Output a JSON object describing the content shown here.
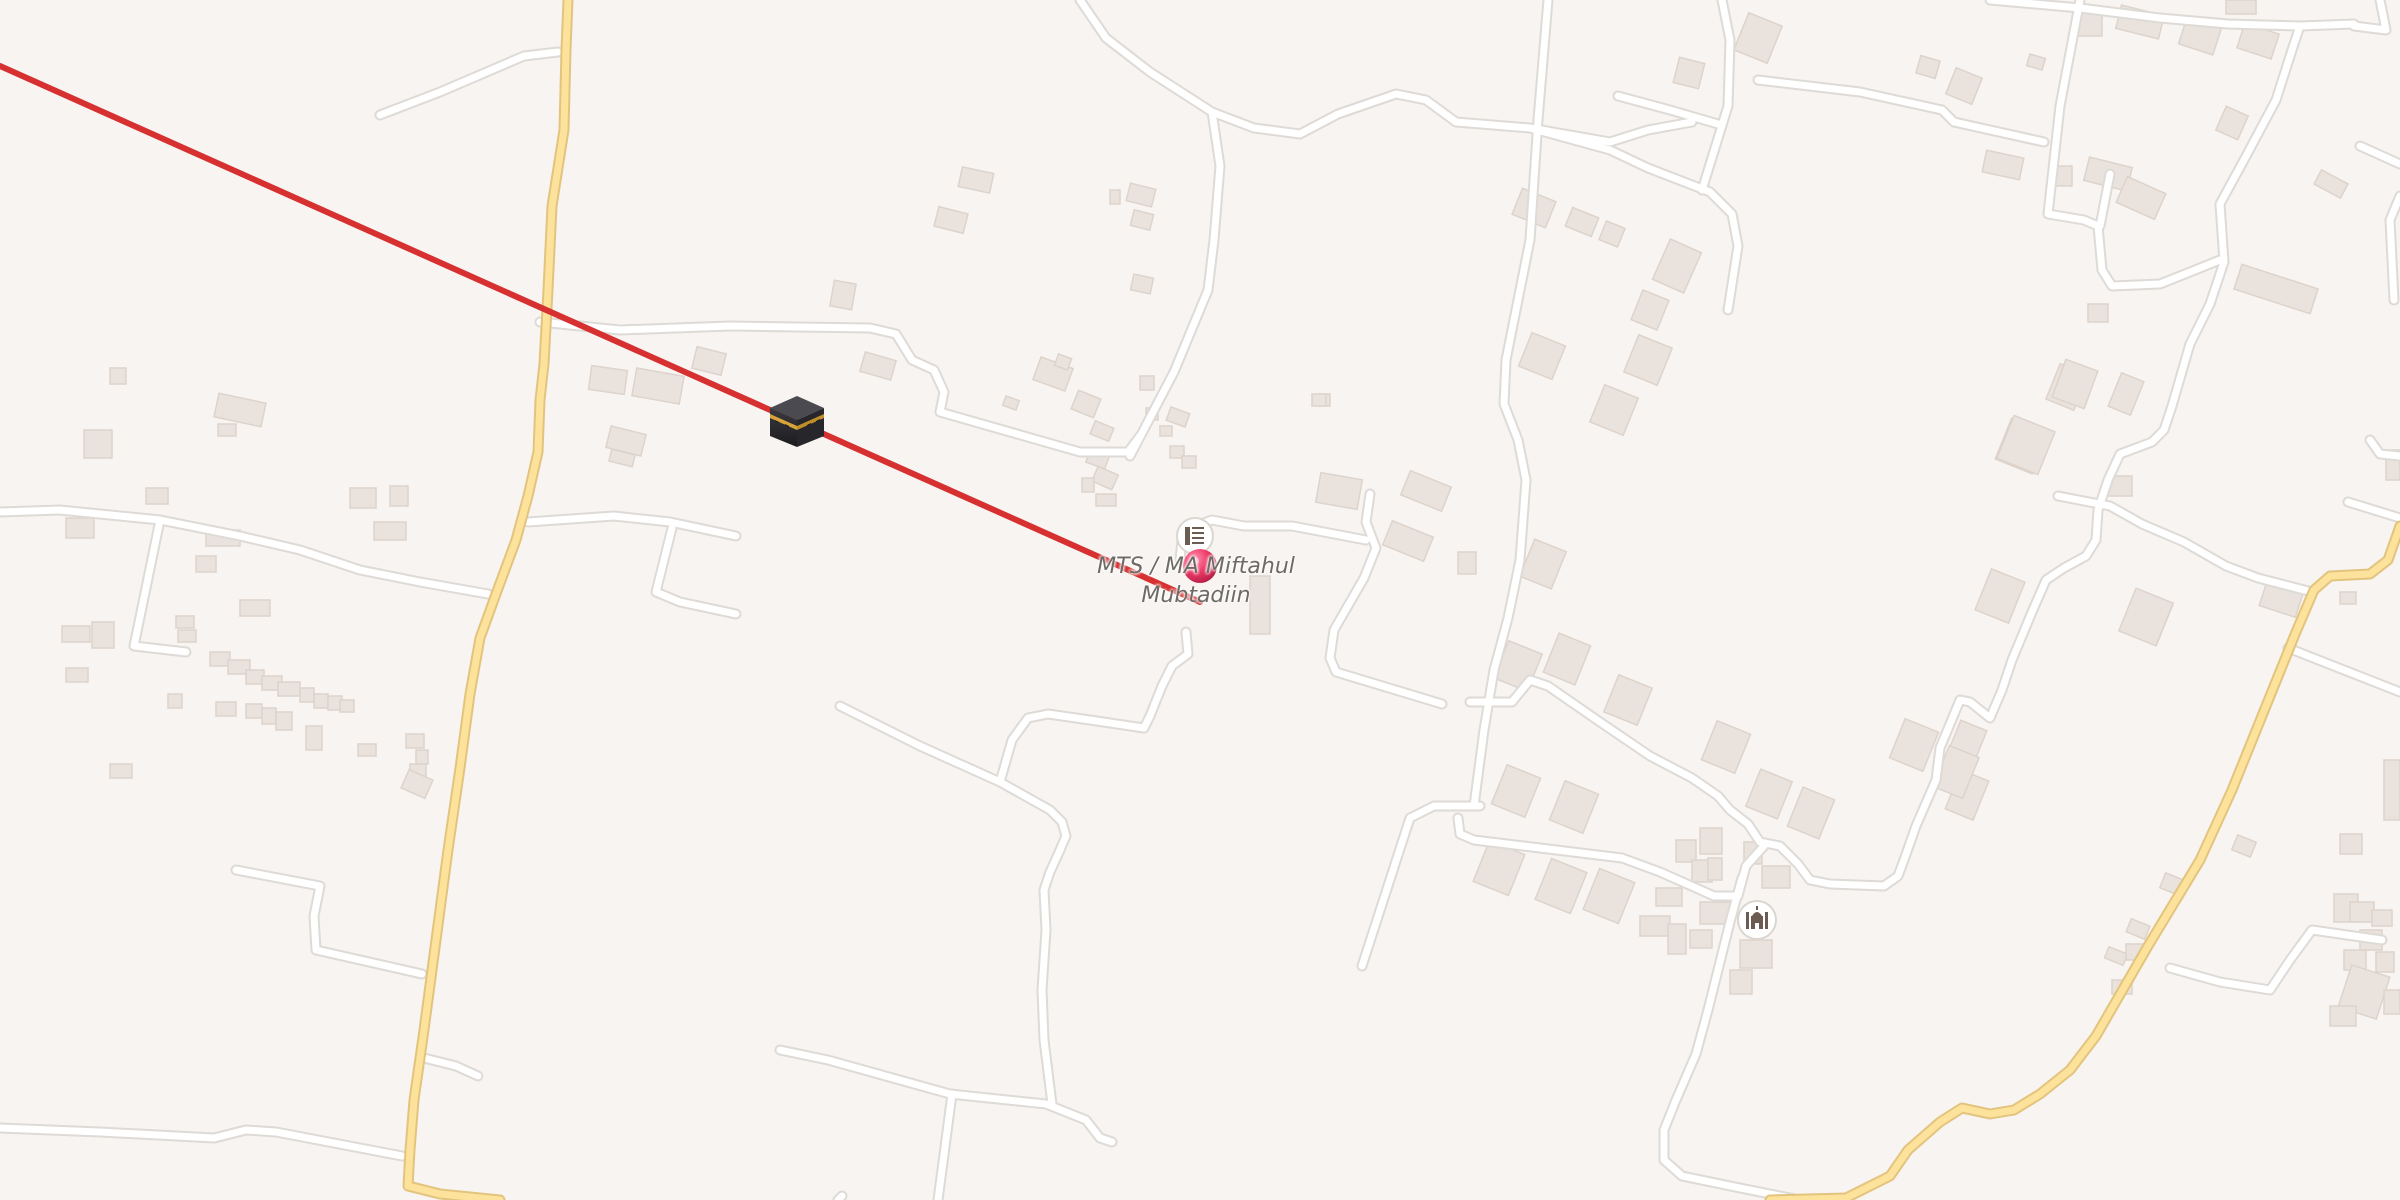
{
  "map": {
    "colors": {
      "land": "#f7f4f1",
      "minor_road": "#ffffff",
      "road_casing": "#dedad6",
      "primary_road": "#fde29b",
      "primary_casing": "#e3c47e",
      "building": "#eae3dd",
      "route_line": "#d63030",
      "marker": "#e8335f"
    },
    "poi_label": {
      "line1": "MTS / MA Miftahul",
      "line2": "Mubtadiin"
    },
    "icons": {
      "kaaba": "kaaba-icon",
      "school": "school-icon",
      "mosque": "mosque-icon",
      "location_marker": "location-pin-icon"
    }
  }
}
